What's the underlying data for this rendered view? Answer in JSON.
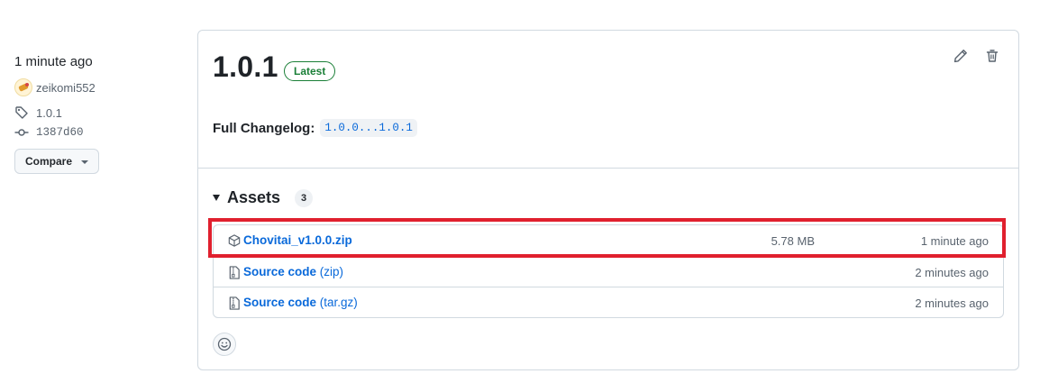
{
  "sidebar": {
    "time": "1 minute ago",
    "author": "zeikomi552",
    "tag": "1.0.1",
    "commit": "1387d60",
    "compare_label": "Compare"
  },
  "release": {
    "title": "1.0.1",
    "badge": "Latest",
    "changelog_label": "Full Changelog:",
    "changelog_link": "1.0.0...1.0.1"
  },
  "assets": {
    "title": "Assets",
    "count": "3",
    "items": [
      {
        "name": "Chovitai_v1.0.0.zip",
        "suffix": "",
        "size": "5.78 MB",
        "date": "1 minute ago",
        "icon": "package-icon"
      },
      {
        "name": "Source code",
        "suffix": " (zip)",
        "size": "",
        "date": "2 minutes ago",
        "icon": "file-zip-icon"
      },
      {
        "name": "Source code",
        "suffix": " (tar.gz)",
        "size": "",
        "date": "2 minutes ago",
        "icon": "file-zip-icon"
      }
    ]
  },
  "colors": {
    "link": "#0969da",
    "badge_green": "#1a7f37",
    "highlight_red": "#e0202e",
    "muted": "#59636e"
  }
}
